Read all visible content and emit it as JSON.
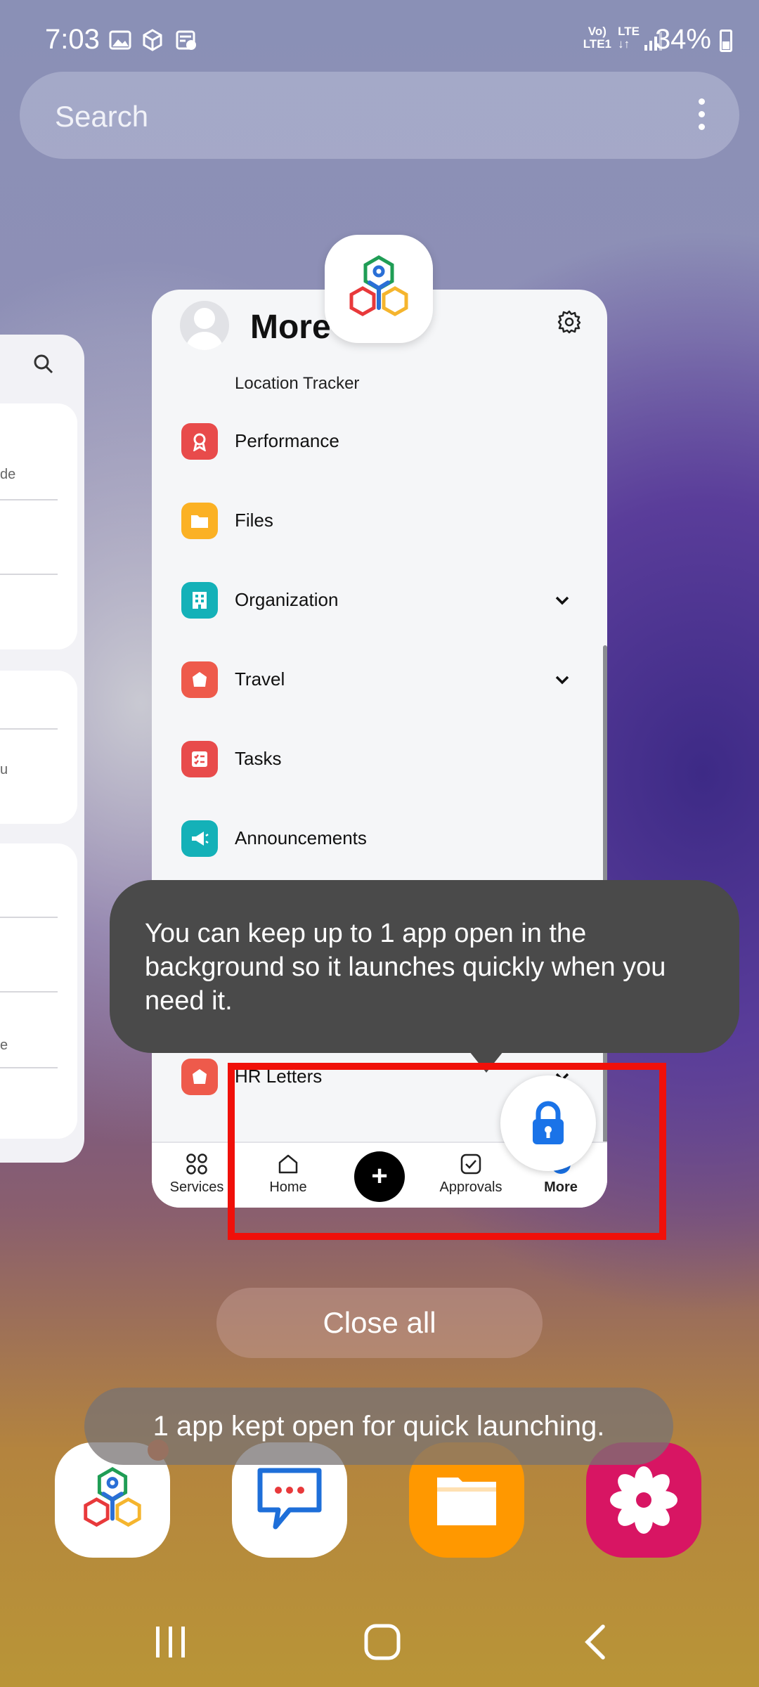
{
  "status_bar": {
    "time": "7:03",
    "network_top": "Vo)",
    "network_bottom": "LTE1",
    "lte": "LTE",
    "battery": "34%"
  },
  "search": {
    "placeholder": "Search",
    "menu_icon": "more-vert-icon"
  },
  "app_card": {
    "title": "More",
    "section_label": "Location Tracker",
    "menu_items": [
      {
        "label": "Performance",
        "icon": "award-icon",
        "color": "#e84b4b",
        "has_chevron": false
      },
      {
        "label": "Files",
        "icon": "folder-icon",
        "color": "#fbb124",
        "has_chevron": false
      },
      {
        "label": "Organization",
        "icon": "building-icon",
        "color": "#14b1b8",
        "has_chevron": true
      },
      {
        "label": "Travel",
        "icon": "travel-icon",
        "color": "#ee5a4b",
        "has_chevron": true
      },
      {
        "label": "Tasks",
        "icon": "tasks-icon",
        "color": "#e84b4b",
        "has_chevron": false
      },
      {
        "label": "Announcements",
        "icon": "megaphone-icon",
        "color": "#14b1b8",
        "has_chevron": false
      },
      {
        "label": "HR Letters",
        "icon": "letter-icon",
        "color": "#ee5a4b",
        "has_chevron": true
      }
    ],
    "bottom_nav": {
      "services": "Services",
      "home": "Home",
      "add": "+",
      "approvals": "Approvals",
      "more": "More"
    }
  },
  "tooltip": {
    "text": "You can keep up to 1 app open in the background so it launches quickly when you need it."
  },
  "close_all": "Close all",
  "toast": "1 app kept open for quick launching.",
  "colors": {
    "highlight": "#f0100a",
    "lock_blue": "#1a73e8",
    "files_orange": "#ff9800",
    "flower_pink": "#d81563",
    "chat_blue": "#1e6fd9"
  }
}
